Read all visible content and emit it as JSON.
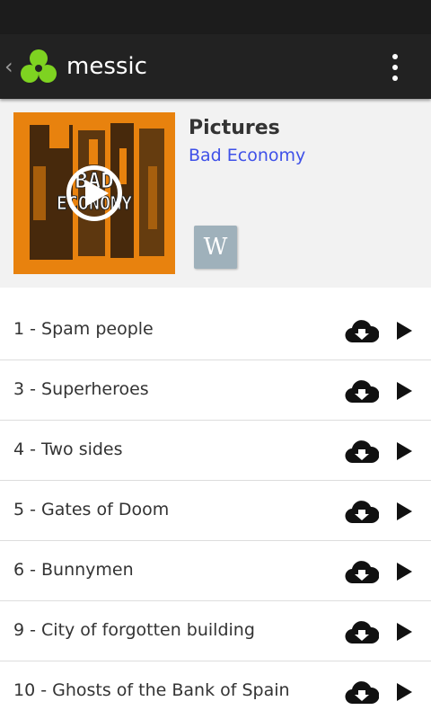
{
  "app": {
    "title": "messic",
    "colors": {
      "logo_green": "#7ed321",
      "link": "#3f51e8",
      "cover_orange": "#e8820e",
      "wiki_bg": "#9fb1bb"
    }
  },
  "album": {
    "title": "Pictures",
    "artist": "Bad Economy",
    "cover_text": [
      "BAD",
      "ECONOMY"
    ],
    "wiki_label": "W"
  },
  "tracks": [
    {
      "label": "1 - Spam people"
    },
    {
      "label": "3 - Superheroes"
    },
    {
      "label": "4 - Two sides"
    },
    {
      "label": "5 - Gates of Doom"
    },
    {
      "label": "6 - Bunnymen"
    },
    {
      "label": "9 - City of forgotten building"
    },
    {
      "label": "10 - Ghosts of the Bank of Spain"
    }
  ],
  "icons": {
    "back": "chevron-left-icon",
    "menu": "overflow-menu-icon",
    "download": "cloud-download-icon",
    "play": "play-icon"
  }
}
